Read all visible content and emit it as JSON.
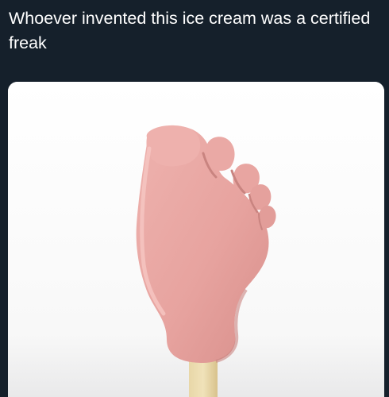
{
  "post": {
    "text": "Whoever invented this ice cream was a certified freak"
  },
  "media": {
    "subject": "foot-shaped-ice-cream-bar",
    "colors": {
      "background": "#15202b",
      "card": "#ffffff",
      "ice_cream": "#e9a7a3",
      "ice_cream_shade": "#d98f8c",
      "stick": "#e3cf9e"
    }
  }
}
